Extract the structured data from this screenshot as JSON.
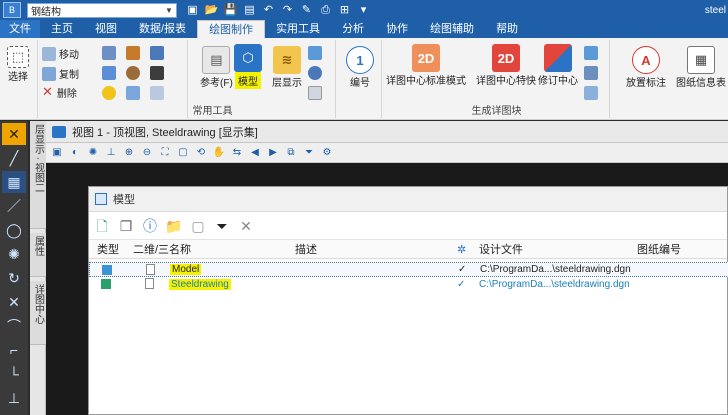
{
  "titlebar": {
    "app_logo": "B",
    "workspace": "钢结构",
    "right_text": "steel"
  },
  "tabs": [
    "文件",
    "主页",
    "视图",
    "数据/报表",
    "绘图制作",
    "实用工具",
    "分析",
    "协作",
    "绘图辅助",
    "帮助"
  ],
  "active_tab_index": 4,
  "ribbon": {
    "select_label": "选择",
    "move_label": "移动",
    "copy_label": "复制",
    "delete_label": "删除",
    "common_tools_label": "常用工具",
    "reference_label": "参考(F)",
    "model_label": "模型",
    "layer_display_label": "层显示",
    "numbering_label": "编号",
    "detail_std_label": "详图中心标准模式",
    "detail_special_label": "详图中心特快",
    "revision_center_label": "修订中心",
    "generate_detail_label": "生成详图块",
    "place_annotation_label": "放置标注",
    "drawing_info_label": "图纸信息表",
    "icon_2d": "2D"
  },
  "side_tabs": [
    "层显示 · 视图二",
    "属性",
    "详图中心"
  ],
  "view": {
    "title": "视图 1 - 顶视图, Steeldrawing [显示集]"
  },
  "dialog": {
    "title": "模型",
    "columns": {
      "type": "类型",
      "dim": "二维/三",
      "name": "名称",
      "desc": "描述",
      "design_file": "设计文件",
      "sheet_number": "图纸编号"
    },
    "rows": [
      {
        "name": "Model",
        "desc": "",
        "check": "✓",
        "file": "C:\\ProgramDa...\\steeldrawing.dgn",
        "selected": true,
        "color": "#222222"
      },
      {
        "name": "Steeldrawing",
        "desc": "",
        "check": "✓",
        "file": "C:\\ProgramDa...\\steeldrawing.dgn",
        "selected": false,
        "color": "#1b7fb8"
      }
    ]
  },
  "colors": {
    "title_blue": "#1e5fa8",
    "highlight_yellow": "#f5f200",
    "red_2d": "#e2453c",
    "orange_2d": "#ef8f5a"
  }
}
